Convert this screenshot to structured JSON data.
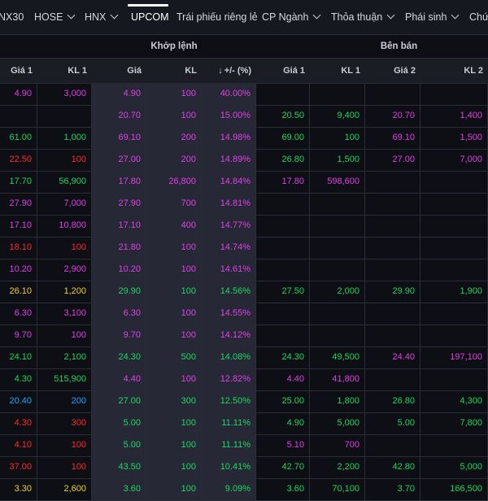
{
  "tabs": [
    {
      "label": "NX30",
      "chevron": false
    },
    {
      "label": "HOSE",
      "chevron": true
    },
    {
      "label": "HNX",
      "chevron": true
    },
    {
      "label": "UPCOM",
      "chevron": false,
      "active": true
    },
    {
      "label": "Trái phiếu riêng lẻ",
      "chevron": false
    },
    {
      "label": "CP Ngành",
      "chevron": true
    },
    {
      "label": "Thỏa thuận",
      "chevron": true
    },
    {
      "label": "Phái sinh",
      "chevron": true
    },
    {
      "label": "Chứ",
      "chevron": false
    }
  ],
  "groups": {
    "match": "Khớp lệnh",
    "sell": "Bên bán"
  },
  "columns": [
    "Giá 1",
    "KL 1",
    "Giá",
    "KL",
    "+/- (%)",
    "Giá 1",
    "KL 1",
    "Giá 2",
    "KL 2"
  ],
  "colors": {
    "purple": "#e040e8",
    "green": "#1ed760",
    "red": "#ff2a2a",
    "yellow": "#f0d02a",
    "cyan": "#1aa6ff",
    "white": "#e6e6e6"
  },
  "rows": [
    [
      [
        "4.90",
        "purple"
      ],
      [
        "3,000",
        "purple"
      ],
      [
        "4.90",
        "purple"
      ],
      [
        "100",
        "purple"
      ],
      [
        "40.00%",
        "purple"
      ],
      [
        "",
        ""
      ],
      [
        "",
        ""
      ],
      [
        "",
        ""
      ],
      [
        "",
        ""
      ]
    ],
    [
      [
        "",
        ""
      ],
      [
        "",
        ""
      ],
      [
        "20.70",
        "purple"
      ],
      [
        "100",
        "purple"
      ],
      [
        "15.00%",
        "purple"
      ],
      [
        "20.50",
        "green"
      ],
      [
        "9,400",
        "green"
      ],
      [
        "20.70",
        "purple"
      ],
      [
        "1,400",
        "purple"
      ]
    ],
    [
      [
        "61.00",
        "green"
      ],
      [
        "1,000",
        "green"
      ],
      [
        "69.10",
        "purple"
      ],
      [
        "200",
        "purple"
      ],
      [
        "14.98%",
        "purple"
      ],
      [
        "69.00",
        "green"
      ],
      [
        "100",
        "green"
      ],
      [
        "69.10",
        "purple"
      ],
      [
        "1,500",
        "purple"
      ]
    ],
    [
      [
        "22.50",
        "red"
      ],
      [
        "100",
        "red"
      ],
      [
        "27.00",
        "purple"
      ],
      [
        "200",
        "purple"
      ],
      [
        "14.89%",
        "purple"
      ],
      [
        "26.80",
        "green"
      ],
      [
        "1,500",
        "green"
      ],
      [
        "27.00",
        "purple"
      ],
      [
        "7,000",
        "purple"
      ]
    ],
    [
      [
        "17.70",
        "green"
      ],
      [
        "56,900",
        "green"
      ],
      [
        "17.80",
        "purple"
      ],
      [
        "26,800",
        "purple"
      ],
      [
        "14.84%",
        "purple"
      ],
      [
        "17.80",
        "purple"
      ],
      [
        "598,600",
        "purple"
      ],
      [
        "",
        ""
      ],
      [
        "",
        ""
      ]
    ],
    [
      [
        "27.90",
        "purple"
      ],
      [
        "7,000",
        "purple"
      ],
      [
        "27.90",
        "purple"
      ],
      [
        "700",
        "purple"
      ],
      [
        "14.81%",
        "purple"
      ],
      [
        "",
        ""
      ],
      [
        "",
        ""
      ],
      [
        "",
        ""
      ],
      [
        "",
        ""
      ]
    ],
    [
      [
        "17.10",
        "purple"
      ],
      [
        "10,800",
        "purple"
      ],
      [
        "17.10",
        "purple"
      ],
      [
        "400",
        "purple"
      ],
      [
        "14.77%",
        "purple"
      ],
      [
        "",
        ""
      ],
      [
        "",
        ""
      ],
      [
        "",
        ""
      ],
      [
        "",
        ""
      ]
    ],
    [
      [
        "18.10",
        "red"
      ],
      [
        "100",
        "red"
      ],
      [
        "21.80",
        "purple"
      ],
      [
        "100",
        "purple"
      ],
      [
        "14.74%",
        "purple"
      ],
      [
        "",
        ""
      ],
      [
        "",
        ""
      ],
      [
        "",
        ""
      ],
      [
        "",
        ""
      ]
    ],
    [
      [
        "10.20",
        "purple"
      ],
      [
        "2,900",
        "purple"
      ],
      [
        "10.20",
        "purple"
      ],
      [
        "100",
        "purple"
      ],
      [
        "14.61%",
        "purple"
      ],
      [
        "",
        ""
      ],
      [
        "",
        ""
      ],
      [
        "",
        ""
      ],
      [
        "",
        ""
      ]
    ],
    [
      [
        "26.10",
        "yellow"
      ],
      [
        "1,200",
        "yellow"
      ],
      [
        "29.90",
        "green"
      ],
      [
        "100",
        "green"
      ],
      [
        "14.56%",
        "green"
      ],
      [
        "27.50",
        "green"
      ],
      [
        "2,000",
        "green"
      ],
      [
        "29.90",
        "green"
      ],
      [
        "1,900",
        "green"
      ]
    ],
    [
      [
        "6.30",
        "purple"
      ],
      [
        "3,100",
        "purple"
      ],
      [
        "6.30",
        "purple"
      ],
      [
        "100",
        "purple"
      ],
      [
        "14.55%",
        "purple"
      ],
      [
        "",
        ""
      ],
      [
        "",
        ""
      ],
      [
        "",
        ""
      ],
      [
        "",
        ""
      ]
    ],
    [
      [
        "9.70",
        "purple"
      ],
      [
        "100",
        "purple"
      ],
      [
        "9.70",
        "purple"
      ],
      [
        "100",
        "purple"
      ],
      [
        "14.12%",
        "purple"
      ],
      [
        "",
        ""
      ],
      [
        "",
        ""
      ],
      [
        "",
        ""
      ],
      [
        "",
        ""
      ]
    ],
    [
      [
        "24.10",
        "green"
      ],
      [
        "2,100",
        "green"
      ],
      [
        "24.30",
        "green"
      ],
      [
        "500",
        "green"
      ],
      [
        "14.08%",
        "green"
      ],
      [
        "24.30",
        "green"
      ],
      [
        "49,500",
        "green"
      ],
      [
        "24.40",
        "purple"
      ],
      [
        "197,100",
        "purple"
      ]
    ],
    [
      [
        "4.30",
        "green"
      ],
      [
        "515,900",
        "green"
      ],
      [
        "4.40",
        "purple"
      ],
      [
        "100",
        "purple"
      ],
      [
        "12.82%",
        "purple"
      ],
      [
        "4.40",
        "purple"
      ],
      [
        "41,800",
        "purple"
      ],
      [
        "",
        ""
      ],
      [
        "",
        ""
      ]
    ],
    [
      [
        "20.40",
        "cyan"
      ],
      [
        "200",
        "cyan"
      ],
      [
        "27.00",
        "green"
      ],
      [
        "300",
        "green"
      ],
      [
        "12.50%",
        "green"
      ],
      [
        "25.00",
        "green"
      ],
      [
        "1,800",
        "green"
      ],
      [
        "26.80",
        "green"
      ],
      [
        "4,300",
        "green"
      ]
    ],
    [
      [
        "4.30",
        "red"
      ],
      [
        "300",
        "red"
      ],
      [
        "5.00",
        "green"
      ],
      [
        "100",
        "green"
      ],
      [
        "11.11%",
        "green"
      ],
      [
        "4.90",
        "green"
      ],
      [
        "5,000",
        "green"
      ],
      [
        "5.00",
        "green"
      ],
      [
        "7,800",
        "green"
      ]
    ],
    [
      [
        "4.10",
        "red"
      ],
      [
        "100",
        "red"
      ],
      [
        "5.00",
        "green"
      ],
      [
        "100",
        "green"
      ],
      [
        "11.11%",
        "green"
      ],
      [
        "5.10",
        "purple"
      ],
      [
        "700",
        "purple"
      ],
      [
        "",
        ""
      ],
      [
        "",
        ""
      ]
    ],
    [
      [
        "37.00",
        "red"
      ],
      [
        "100",
        "red"
      ],
      [
        "43.50",
        "green"
      ],
      [
        "100",
        "green"
      ],
      [
        "10.41%",
        "green"
      ],
      [
        "42.70",
        "green"
      ],
      [
        "2,200",
        "green"
      ],
      [
        "42.80",
        "green"
      ],
      [
        "5,000",
        "green"
      ]
    ],
    [
      [
        "3.30",
        "yellow"
      ],
      [
        "2,600",
        "yellow"
      ],
      [
        "3.60",
        "green"
      ],
      [
        "100",
        "green"
      ],
      [
        "9.09%",
        "green"
      ],
      [
        "3.60",
        "green"
      ],
      [
        "70,100",
        "green"
      ],
      [
        "3.70",
        "green"
      ],
      [
        "166,500",
        "green"
      ]
    ]
  ]
}
